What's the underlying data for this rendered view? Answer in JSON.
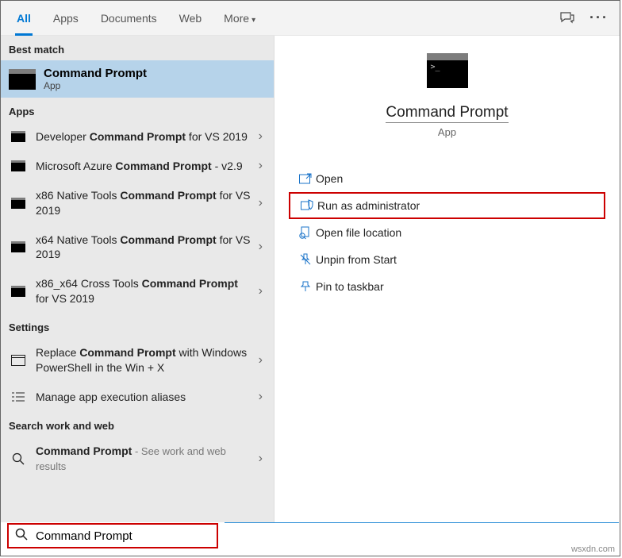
{
  "tabs": {
    "all": "All",
    "apps": "Apps",
    "documents": "Documents",
    "web": "Web",
    "more": "More"
  },
  "sections": {
    "best_match": "Best match",
    "apps": "Apps",
    "settings": "Settings",
    "search_work_web": "Search work and web"
  },
  "best_match": {
    "title": "Command Prompt",
    "subtitle": "App"
  },
  "apps_list": [
    {
      "prefix": "Developer ",
      "bold": "Command Prompt",
      "suffix": " for VS 2019"
    },
    {
      "prefix": "Microsoft Azure ",
      "bold": "Command Prompt",
      "suffix": " - v2.9"
    },
    {
      "prefix": "x86 Native Tools ",
      "bold": "Command Prompt",
      "suffix": " for VS 2019"
    },
    {
      "prefix": "x64 Native Tools ",
      "bold": "Command Prompt",
      "suffix": " for VS 2019"
    },
    {
      "prefix": "x86_x64 Cross Tools ",
      "bold": "Command Prompt",
      "suffix": " for VS 2019"
    }
  ],
  "settings_list": [
    {
      "prefix": "Replace ",
      "bold": "Command Prompt",
      "suffix": " with Windows PowerShell in the Win + X"
    },
    {
      "plain": "Manage app execution aliases"
    }
  ],
  "web_row": {
    "bold": "Command Prompt",
    "hint": " - See work and web results"
  },
  "search": {
    "value": "Command Prompt"
  },
  "detail": {
    "title": "Command Prompt",
    "subtitle": "App",
    "actions": {
      "open": "Open",
      "run_admin": "Run as administrator",
      "open_loc": "Open file location",
      "unpin_start": "Unpin from Start",
      "pin_taskbar": "Pin to taskbar"
    }
  },
  "watermark": "wsxdn.com"
}
